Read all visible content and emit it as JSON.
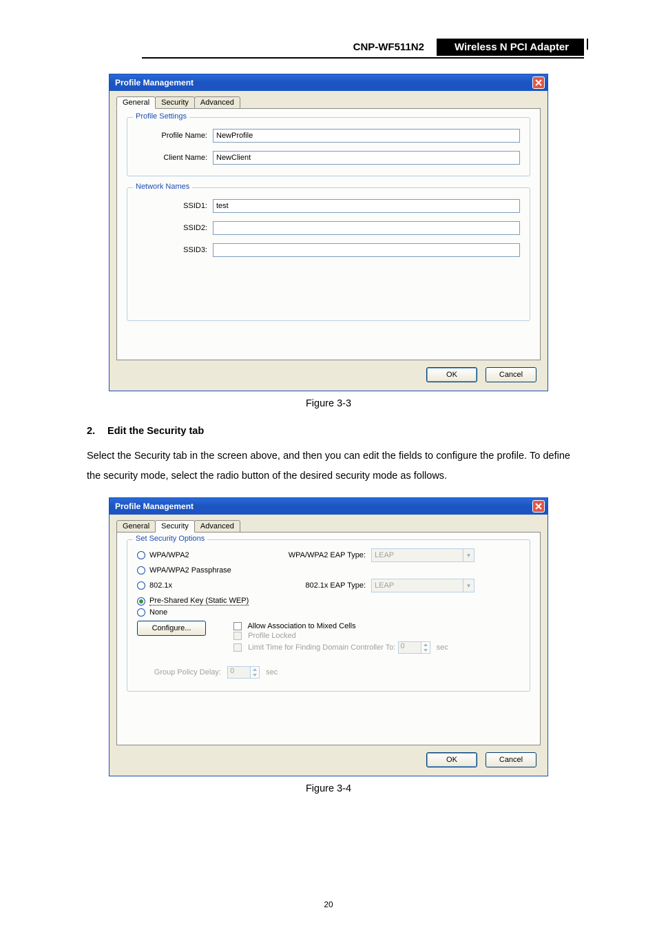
{
  "header": {
    "model": "CNP-WF511N2",
    "product": "Wireless N PCI Adapter"
  },
  "dialog1": {
    "title": "Profile Management",
    "tabs": {
      "general": "General",
      "security": "Security",
      "advanced": "Advanced"
    },
    "profile_settings": {
      "legend": "Profile Settings",
      "profile_name_label": "Profile Name:",
      "profile_name_value": "NewProfile",
      "client_name_label": "Client Name:",
      "client_name_value": "NewClient"
    },
    "network_names": {
      "legend": "Network Names",
      "ssid1_label": "SSID1:",
      "ssid1_value": "test",
      "ssid2_label": "SSID2:",
      "ssid2_value": "",
      "ssid3_label": "SSID3:",
      "ssid3_value": ""
    },
    "buttons": {
      "ok": "OK",
      "cancel": "Cancel"
    }
  },
  "figure1_caption": "Figure 3-3",
  "step2": {
    "num": "2.",
    "title": "Edit the Security tab"
  },
  "body_text": "Select the Security tab in the screen above, and then you can edit the fields to configure the profile. To define the security mode, select the radio button of the desired security mode as follows.",
  "dialog2": {
    "title": "Profile Management",
    "tabs": {
      "general": "General",
      "security": "Security",
      "advanced": "Advanced"
    },
    "security_options": {
      "legend": "Set Security Options",
      "wpa": "WPA/WPA2",
      "wpa_psk": "WPA/WPA2 Passphrase",
      "dot1x": "802.1x",
      "psk_wep": "Pre-Shared Key (Static WEP)",
      "none": "None",
      "wpa_eap_label": "WPA/WPA2 EAP Type:",
      "wpa_eap_value": "LEAP",
      "dot1x_eap_label": "802.1x EAP Type:",
      "dot1x_eap_value": "LEAP",
      "configure_btn": "Configure...",
      "allow_mixed": "Allow Association to Mixed Cells",
      "profile_locked": "Profile Locked",
      "limit_time_label": "Limit Time for Finding Domain Controller To:",
      "limit_time_value": "0",
      "limit_time_unit": "sec",
      "group_policy_label": "Group Policy Delay:",
      "group_policy_value": "0",
      "group_policy_unit": "sec"
    },
    "buttons": {
      "ok": "OK",
      "cancel": "Cancel"
    }
  },
  "figure2_caption": "Figure 3-4",
  "page_number": "20"
}
